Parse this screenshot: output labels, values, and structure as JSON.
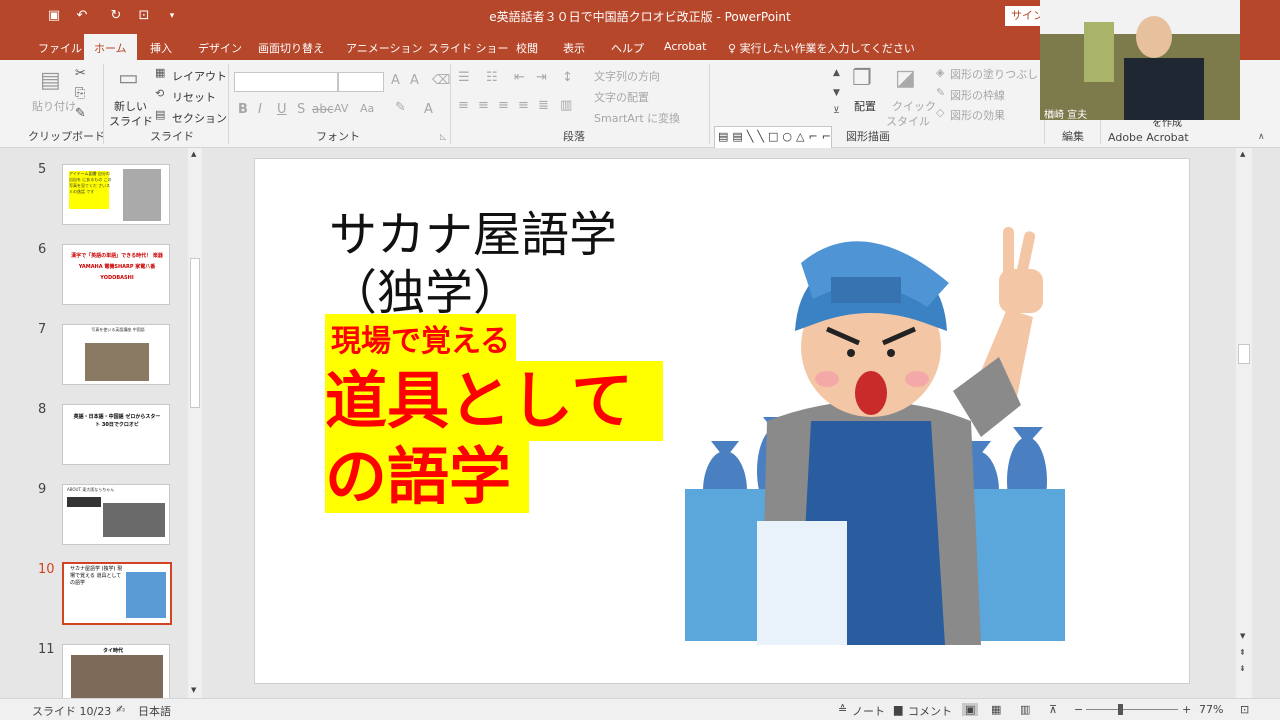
{
  "window": {
    "title": "e英語話者３０日で中国語クロオビ改正版 - PowerPoint",
    "signin_label": "サイン"
  },
  "tabs": [
    "ファイル",
    "ホーム",
    "挿入",
    "デザイン",
    "画面切り替え",
    "アニメーション",
    "スライド ショー",
    "校閲",
    "表示",
    "ヘルプ",
    "Acrobat"
  ],
  "tell_me": "実行したい作業を入力してください",
  "ribbon": {
    "clipboard": {
      "paste": "貼り付け",
      "label": "クリップボード"
    },
    "slides": {
      "new_slide_1": "新しい",
      "new_slide_2": "スライド",
      "layout": "レイアウト",
      "reset": "リセット",
      "section": "セクション",
      "label": "スライド"
    },
    "font": {
      "label": "フォント",
      "bold": "B",
      "italic": "I",
      "underline": "U",
      "strike": "S",
      "spacing": "AV",
      "size": "Aa",
      "color": "A"
    },
    "paragraph": {
      "label": "段落",
      "text_direction": "文字列の方向",
      "align_text": "文字の配置",
      "smartart": "SmartArt に変換"
    },
    "drawing": {
      "label": "図形描画",
      "arrange": "配置",
      "quick_styles_1": "クイック",
      "quick_styles_2": "スタイル",
      "fill": "図形の塗りつぶし",
      "outline": "図形の枠線",
      "effects": "図形の効果"
    },
    "editing": {
      "label": "編集"
    },
    "acrobat": {
      "label": "Adobe Acrobat",
      "create": "を作成"
    }
  },
  "slides_panel": [
    {
      "num": "5",
      "text": "アイテーム図書 自分の出自を にあるもの この写真を見てくだ さいスミの逸話 です"
    },
    {
      "num": "6",
      "text": "漢字で「英語の単語」できる時代！ 楽器YAMAHA 電機SHARP 家電八番YODOBASHI"
    },
    {
      "num": "7",
      "text": "写真を使いる英語講座 中国語"
    },
    {
      "num": "8",
      "text": "英語・日本語・中国語 ゼロからスタート 30日でクロオビ"
    },
    {
      "num": "9",
      "text": "ABOUT 東大阪ならちゃん"
    },
    {
      "num": "10",
      "text": "サカナ屋語学 (独学) 現場で覚える 道具として の語学"
    },
    {
      "num": "11",
      "text": "タイ時代"
    }
  ],
  "slide": {
    "title_line1": "サカナ屋語学",
    "title_line2": "（独学）",
    "sub": "現場で覚える",
    "big1": "道具として",
    "big2": "の語学"
  },
  "webcam": {
    "name": "楢崎 宣夫"
  },
  "status": {
    "slide_info": "スライド 10/23",
    "language": "日本語",
    "notes": "ノート",
    "comments": "コメント",
    "zoom": "77%"
  },
  "colors": {
    "accent": "#b7472a",
    "highlight": "#ffff00",
    "red_text": "#ff0000"
  }
}
